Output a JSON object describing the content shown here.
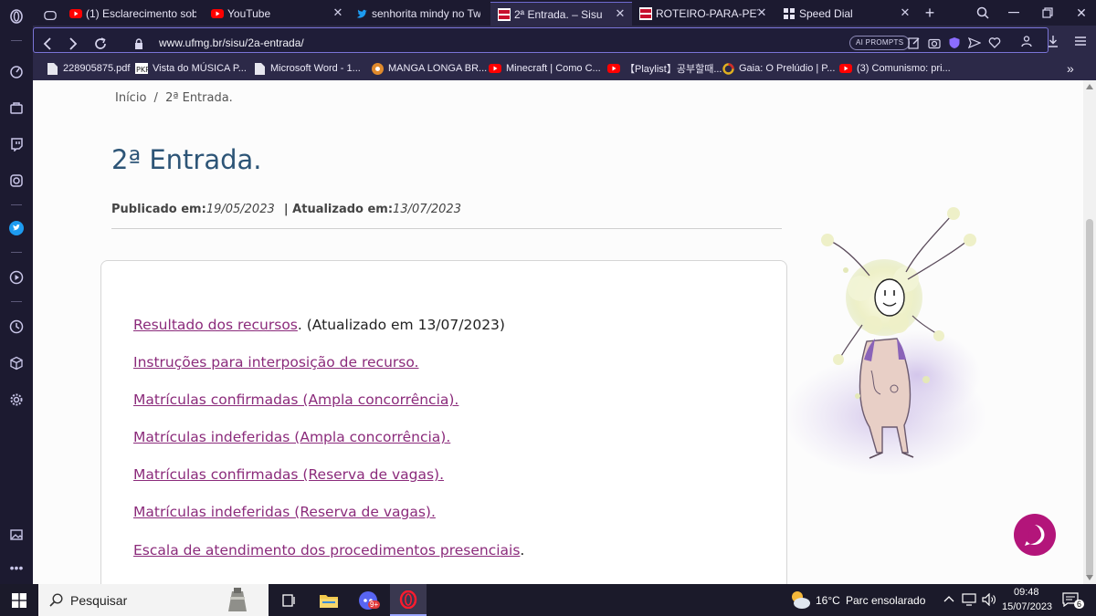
{
  "browser": {
    "tabs": [
      {
        "title": "(1) Esclarecimento sob",
        "favicon": "youtube-icon",
        "active": false
      },
      {
        "title": "YouTube",
        "favicon": "youtube-icon",
        "active": false
      },
      {
        "title": "senhorita mindy no Tw",
        "favicon": "twitter-icon",
        "active": false
      },
      {
        "title": "2ª Entrada. – Sisu",
        "favicon": "ufmg-icon",
        "active": true
      },
      {
        "title": "ROTEIRO-PARA-PETICIO",
        "favicon": "ufmg-icon",
        "active": false
      },
      {
        "title": "Speed Dial",
        "favicon": "grid-icon",
        "active": false
      }
    ],
    "new_tab": "+",
    "url": "www.ufmg.br/sisu/2a-entrada/",
    "ai_prompts_label": "AI PROMPTS",
    "bookmarks": [
      {
        "label": "228905875.pdf",
        "icon": "document-icon"
      },
      {
        "label": "Vista do MÚSICA P...",
        "icon": "pkp-icon"
      },
      {
        "label": "Microsoft Word - 1...",
        "icon": "document-icon"
      },
      {
        "label": "MANGA LONGA BR...",
        "icon": "site-icon"
      },
      {
        "label": "Minecraft | Como C...",
        "icon": "youtube-icon"
      },
      {
        "label": "【Playlist】공부할때...",
        "icon": "youtube-icon"
      },
      {
        "label": "Gaia: O Prelúdio | P...",
        "icon": "ring-icon"
      },
      {
        "label": "(3) Comunismo: pri...",
        "icon": "youtube-icon"
      }
    ],
    "more_bookmarks": "»"
  },
  "page": {
    "breadcrumb_home": "Início",
    "breadcrumb_sep": "/",
    "breadcrumb_current": "2ª Entrada.",
    "title": "2ª Entrada.",
    "published_label": "Publicado em:",
    "published_date": "19/05/2023",
    "updated_label": "| Atualizado em:",
    "updated_date": "13/07/2023",
    "links": [
      {
        "text": "Resultado dos recursos",
        "suffix": ". (Atualizado em 13/07/2023)"
      },
      {
        "text": "Instruções para interposição de recurso.",
        "suffix": ""
      },
      {
        "text": "Matrículas confirmadas (Ampla concorrência).",
        "suffix": ""
      },
      {
        "text": "Matrículas indeferidas (Ampla concorrência).",
        "suffix": ""
      },
      {
        "text": "Matrículas confirmadas (Reserva de vagas).",
        "suffix": ""
      },
      {
        "text": "Matrículas indeferidas (Reserva de vagas).",
        "suffix": ""
      },
      {
        "text": "Escala de atendimento dos procedimentos presenciais",
        "suffix": "."
      }
    ]
  },
  "taskbar": {
    "search_placeholder": "Pesquisar",
    "discord_badge": "9+",
    "weather_temp": "16°C",
    "weather_desc": "Parc ensolarado",
    "time": "09:48",
    "date": "15/07/2023",
    "notifications": "6"
  },
  "colors": {
    "link": "#8b2b7b",
    "title": "#2d5577",
    "browser_bg": "#1c1a30",
    "chat_button": "#b3157a"
  }
}
